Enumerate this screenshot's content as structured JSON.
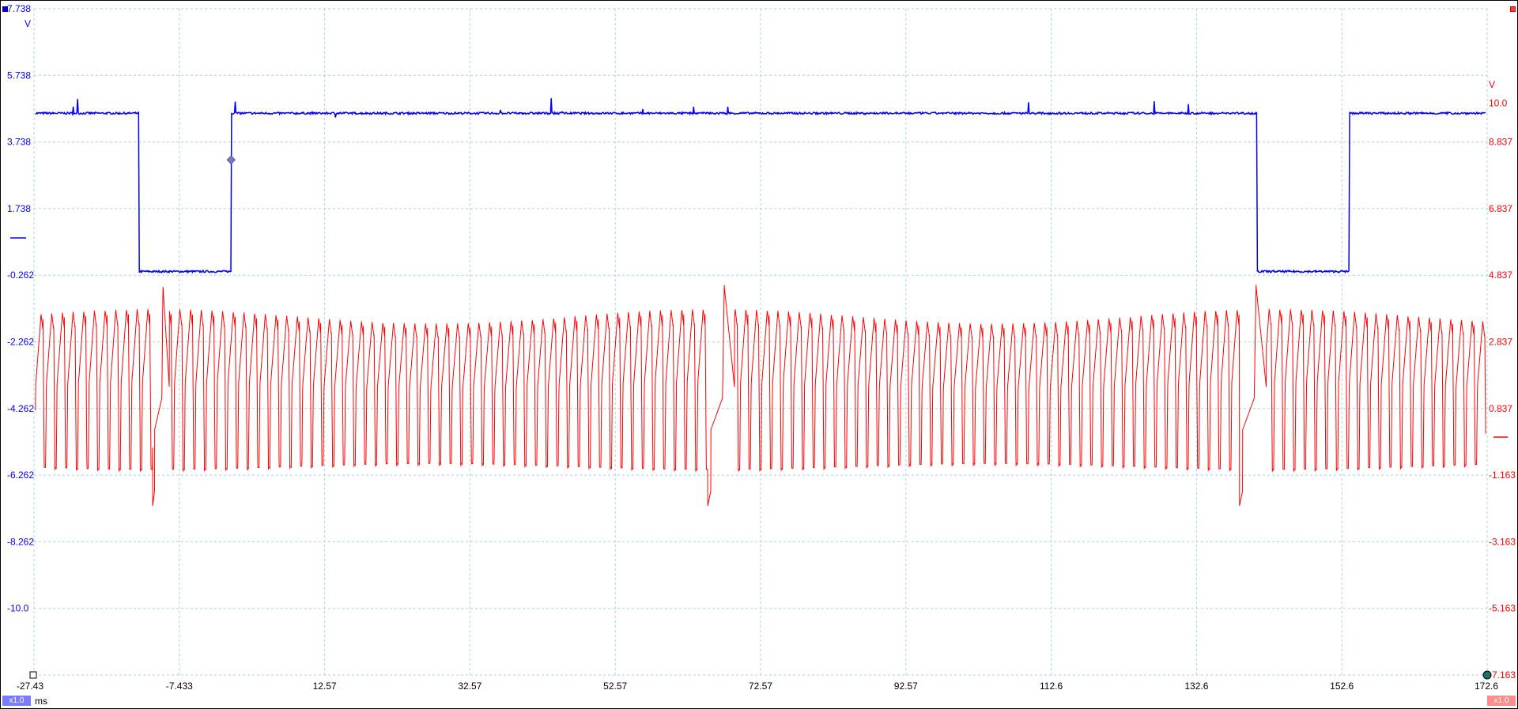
{
  "chart_data": {
    "type": "line",
    "title": "",
    "x_axis": {
      "label": "ms",
      "ticks": [
        "-27.43",
        "-7.433",
        "12.57",
        "32.57",
        "52.57",
        "72.57",
        "92.57",
        "112.6",
        "132.6",
        "152.6",
        "172.6"
      ],
      "range": [
        -27.43,
        172.6
      ]
    },
    "left_axis": {
      "unit": "V",
      "ticks": [
        "7.738",
        "5.738",
        "3.738",
        "1.738",
        "-0.262",
        "-2.262",
        "-4.262",
        "-6.262",
        "-8.262",
        "-10.0"
      ],
      "range": [
        -12.262,
        7.738
      ]
    },
    "right_axis": {
      "unit": "V",
      "ticks": [
        "10.0",
        "8.837",
        "6.837",
        "4.837",
        "2.837",
        "0.837",
        "-1.163",
        "-3.163",
        "-5.163",
        "-7.163"
      ],
      "range": [
        -7.163,
        12.837
      ]
    },
    "grid": true,
    "series": [
      {
        "axis": "left",
        "color": "#0000ff",
        "low_pulses_ms": [
          [
            -13.0,
            -0.3
          ],
          [
            140.9,
            153.6
          ]
        ],
        "high_level": 4.6,
        "low_level": -0.15
      },
      {
        "axis": "right",
        "color": "#ff0000",
        "oscillation_period_ms": 1.47,
        "upper_peak": 3.6,
        "lower_trough": -1.0,
        "transient_events_ms": [
          [
            -11.1,
            -8.8
          ],
          [
            65.3,
            69.0
          ],
          [
            138.5,
            142.2
          ]
        ]
      }
    ],
    "markers": {
      "trigger_x_ms": -0.3,
      "trigger_y": 3.2
    }
  },
  "footer": {
    "left_badge": "x1.0",
    "right_badge": "x1.0",
    "x_unit": "ms"
  },
  "colors": {
    "channel_a": "#0000ff",
    "channel_b": "#ff0000",
    "grid": "#a7d3e3"
  }
}
